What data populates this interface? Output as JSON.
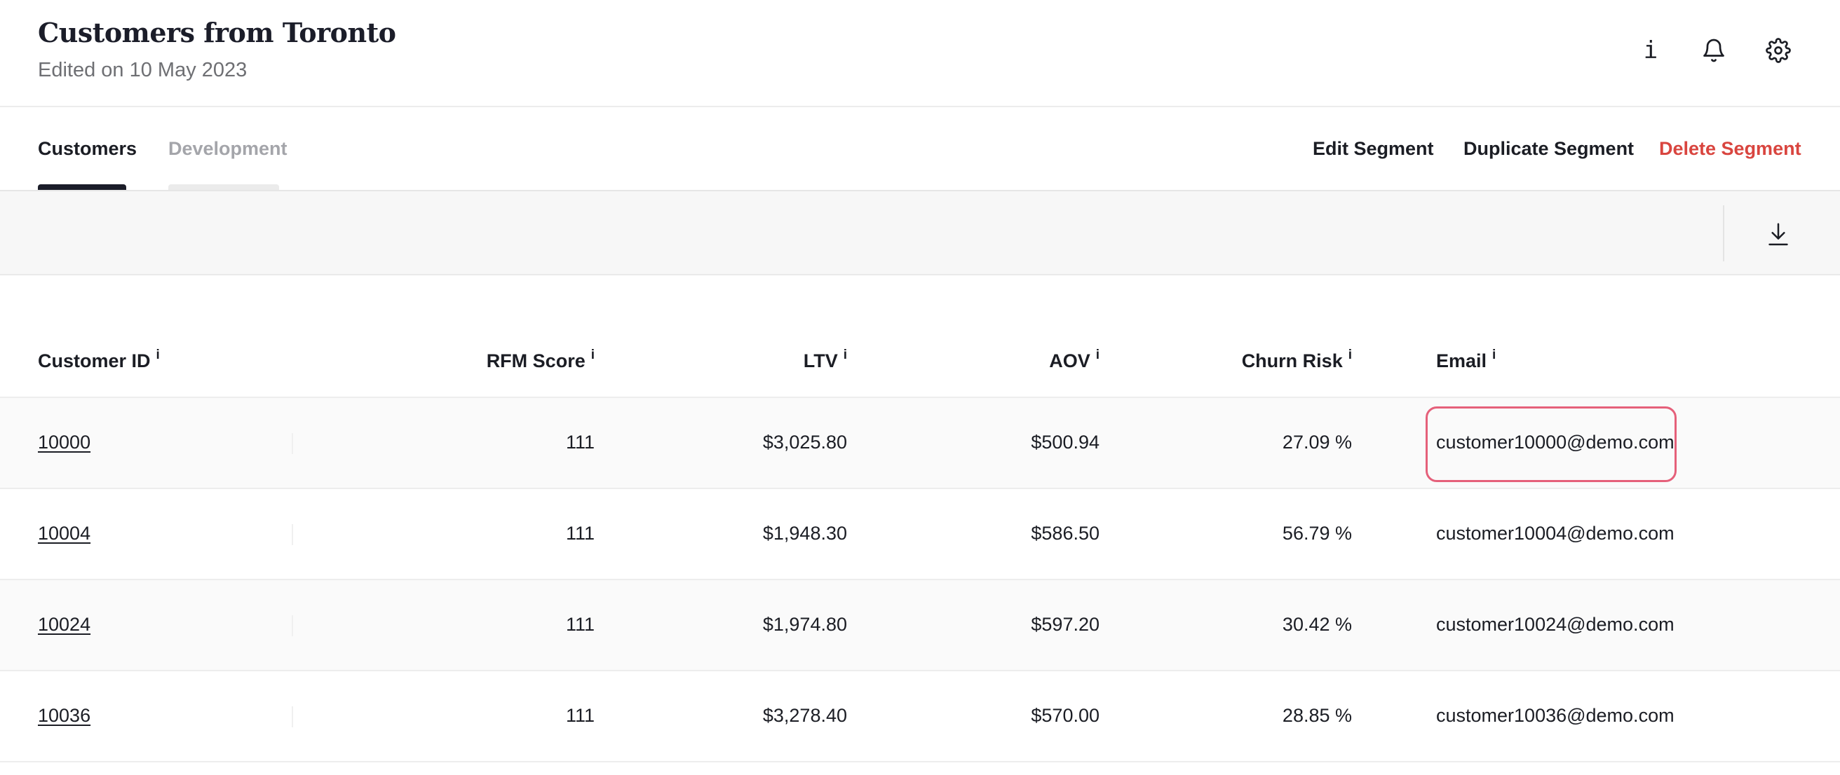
{
  "header": {
    "title": "Customers from Toronto",
    "subtitle": "Edited on 10 May 2023",
    "info_icon_glyph": "i"
  },
  "tabs": [
    {
      "label": "Customers",
      "active": true
    },
    {
      "label": "Development",
      "active": false
    }
  ],
  "actions": {
    "edit": "Edit Segment",
    "duplicate": "Duplicate Segment",
    "delete": "Delete Segment",
    "delete_color": "#d9453f"
  },
  "table": {
    "info_marker": "i",
    "columns": [
      "Customer ID",
      "RFM Score",
      "LTV",
      "AOV",
      "Churn Risk",
      "Email"
    ],
    "rows": [
      {
        "id": "10000",
        "rfm": "111",
        "ltv": "$3,025.80",
        "aov": "$500.94",
        "churn": "27.09 %",
        "email": "customer10000@demo.com"
      },
      {
        "id": "10004",
        "rfm": "111",
        "ltv": "$1,948.30",
        "aov": "$586.50",
        "churn": "56.79 %",
        "email": "customer10004@demo.com"
      },
      {
        "id": "10024",
        "rfm": "111",
        "ltv": "$1,974.80",
        "aov": "$597.20",
        "churn": "30.42 %",
        "email": "customer10024@demo.com"
      },
      {
        "id": "10036",
        "rfm": "111",
        "ltv": "$3,278.40",
        "aov": "$570.00",
        "churn": "28.85 %",
        "email": "customer10036@demo.com"
      }
    ]
  },
  "colors": {
    "accent_dark": "#1b1d29",
    "focus_ring": "#e5607a",
    "muted_tab": "#a4a5aa"
  },
  "icons": [
    "info-icon",
    "bell-icon",
    "gear-icon",
    "download-icon"
  ]
}
